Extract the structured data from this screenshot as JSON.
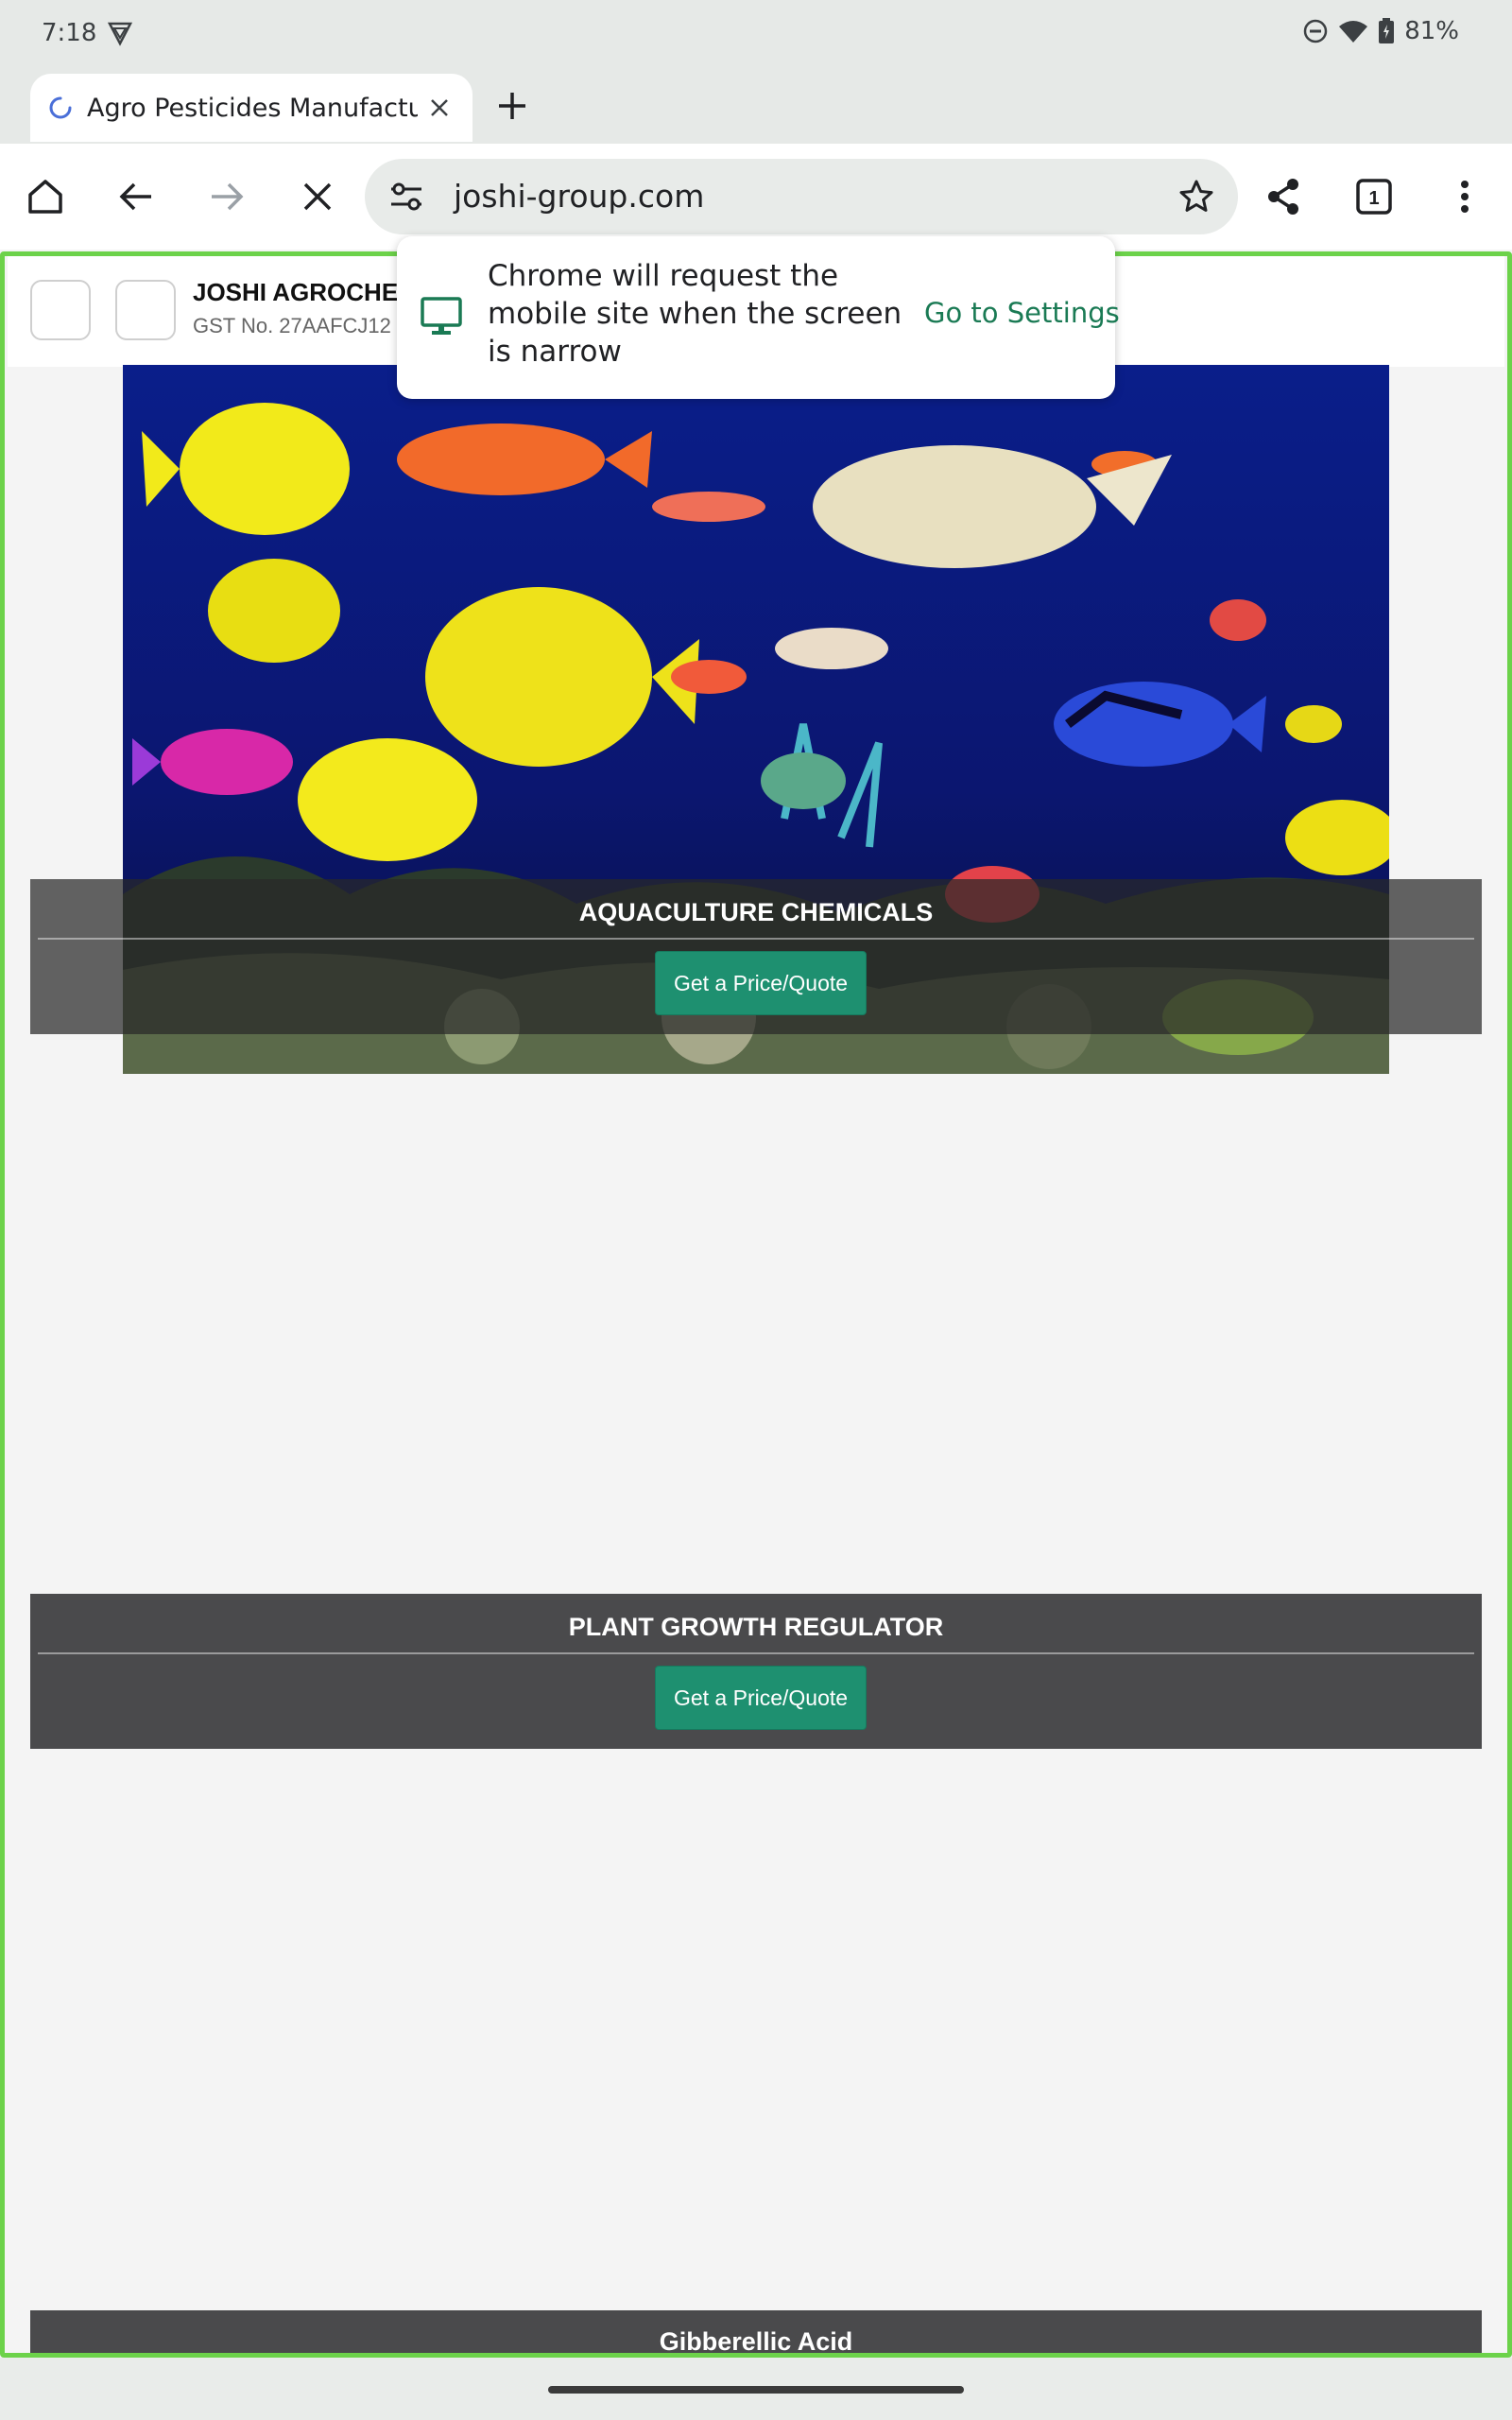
{
  "status_bar": {
    "time": "7:18",
    "battery": "81%"
  },
  "tab": {
    "title": "Agro Pesticides Manufacturer"
  },
  "omnibox": {
    "url": "joshi-group.com"
  },
  "toolbar": {
    "tab_count": "1"
  },
  "message_bubble": {
    "text": "Chrome will request the mobile site when the screen is narrow",
    "action": "Go to Settings"
  },
  "site_header": {
    "company_name": "JOSHI AGROCHE",
    "gst": "GST No. 27AAFCJ12"
  },
  "categories": [
    {
      "title": "AQUACULTURE CHEMICALS",
      "button": "Get a Price/Quote"
    },
    {
      "title": "PLANT GROWTH REGULATOR",
      "button": "Get a Price/Quote"
    },
    {
      "title": "Gibberellic Acid"
    }
  ],
  "colors": {
    "accent_green": "#1e9070",
    "highlight_frame": "#6cd24a",
    "link_green": "#1a7a54"
  }
}
